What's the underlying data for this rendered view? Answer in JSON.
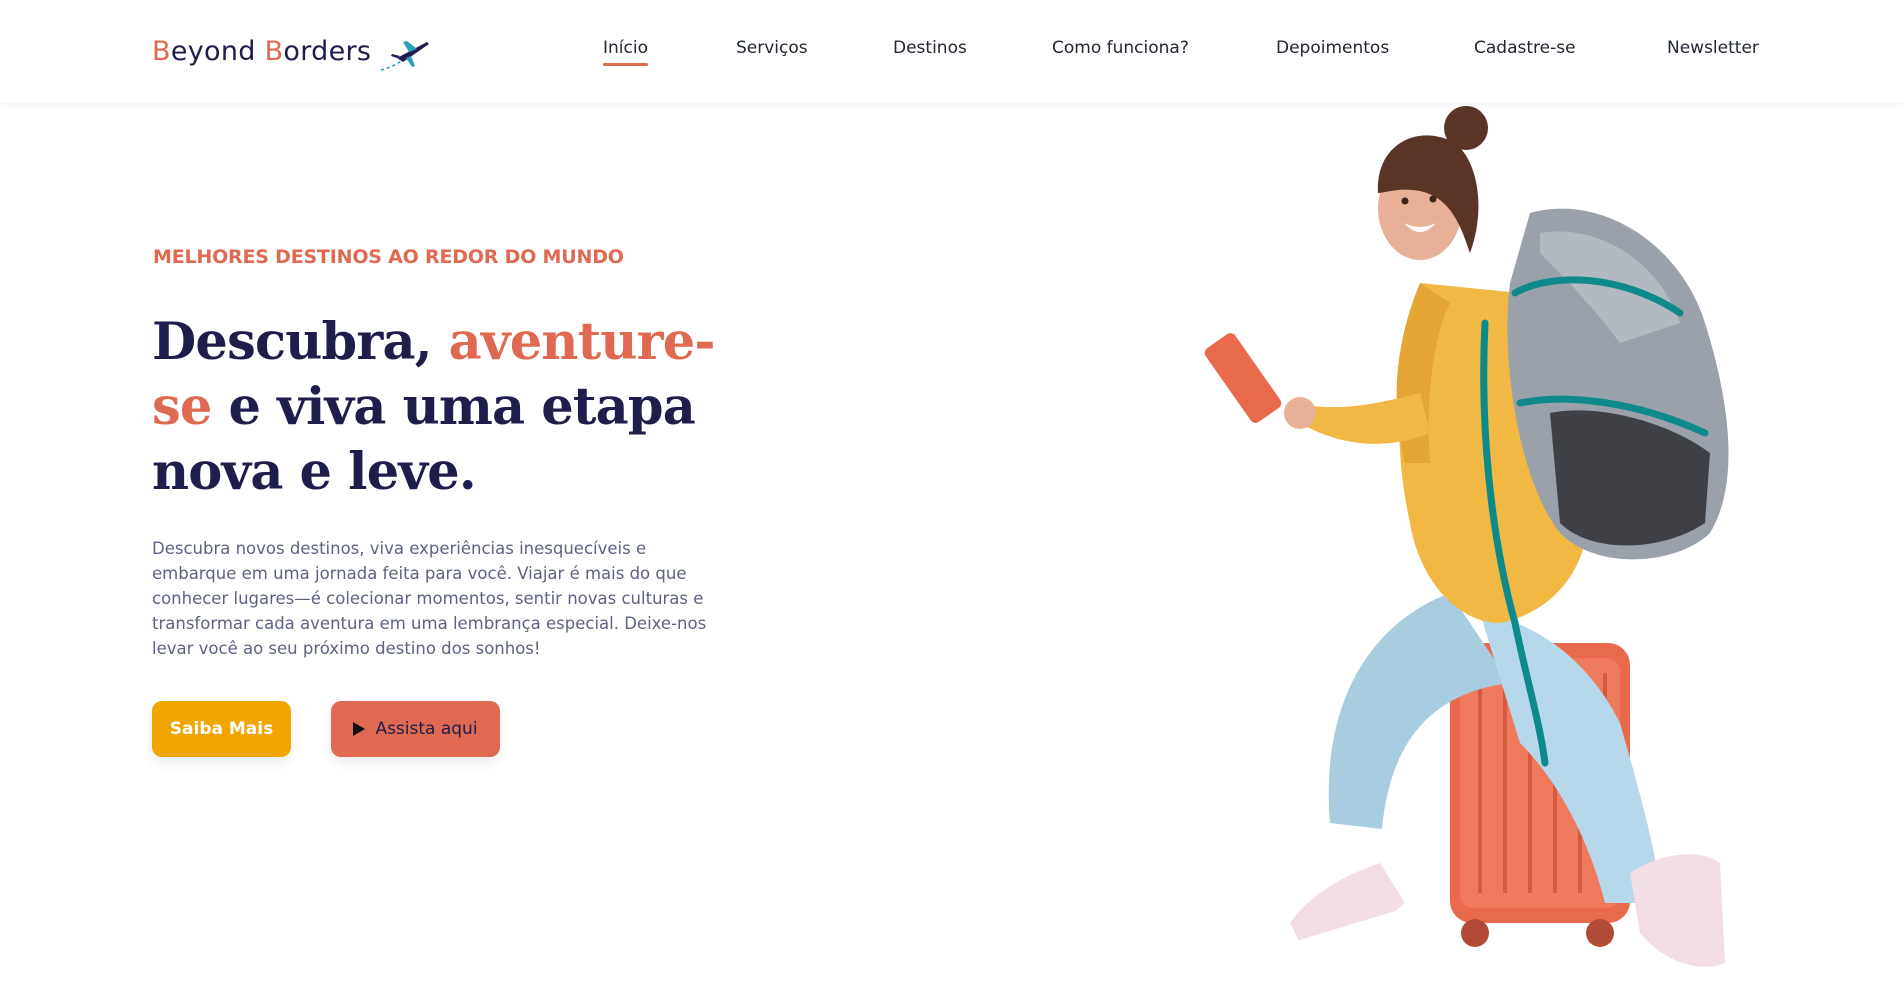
{
  "header": {
    "logo": {
      "first_cap": "B",
      "first_rest": "eyond ",
      "second_cap": "B",
      "second_rest": "orders"
    },
    "nav": [
      {
        "label": "Início",
        "active": true
      },
      {
        "label": "Serviços",
        "active": false
      },
      {
        "label": "Destinos",
        "active": false
      },
      {
        "label": "Como funciona?",
        "active": false
      },
      {
        "label": "Depoimentos",
        "active": false
      },
      {
        "label": "Cadastre-se",
        "active": false
      },
      {
        "label": "Newsletter",
        "active": false
      }
    ]
  },
  "hero": {
    "eyebrow": "MELHORES DESTINOS AO REDOR DO MUNDO",
    "headline": {
      "part1": "Descubra, ",
      "accent": "aventure-se",
      "part2": " e viva uma etapa nova e leve."
    },
    "description": "Descubra novos destinos, viva experiências inesquecíveis e embarque em uma jornada feita para você. Viajar é mais do que conhecer lugares—é colecionar momentos, sentir novas culturas e transformar cada aventura em uma lembrança especial. Deixe-nos levar você ao seu próximo destino dos sonhos!",
    "primary_button": "Saiba Mais",
    "secondary_button": "Assista aqui"
  },
  "icons": {
    "logo": "airplane-icon",
    "play": "play-icon",
    "hero": "traveler-illustration"
  },
  "colors": {
    "accent": "#df6951",
    "primary_button": "#f1a501",
    "heading": "#1e1d4c",
    "body_text": "#5e6282"
  }
}
